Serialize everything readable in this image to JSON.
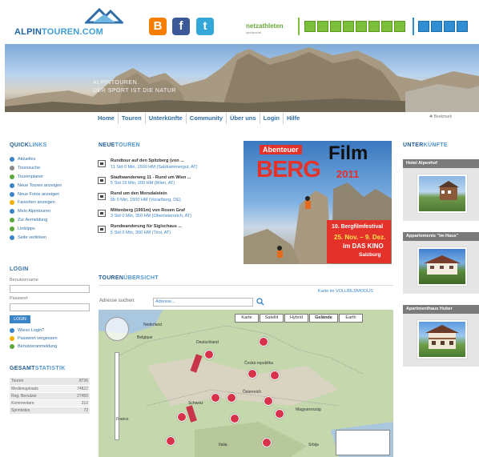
{
  "header": {
    "logo_part1": "ALPIN",
    "logo_part2": "TOUREN.COM",
    "social": [
      "B",
      "f",
      "t"
    ],
    "partner": "netzathleten",
    "partner_sub": "sportportal"
  },
  "banner": {
    "caption_line1": "ALPINTOUREN.",
    "caption_line2": "DER SPORT IST DIE NATUR"
  },
  "nav": {
    "items": [
      "Home",
      "Touren",
      "Unterkünfte",
      "Community",
      "Über uns",
      "Login",
      "Hilfe"
    ],
    "bookmark": "Bookmark"
  },
  "quicklinks": {
    "title_bold": "QUICK",
    "title_light": "LINKS",
    "items": [
      {
        "label": "Aktuelles",
        "color": "#3a84c8"
      },
      {
        "label": "Tourssuche",
        "color": "#8a8a8a"
      },
      {
        "label": "Tourenplaner",
        "color": "#5aa83a"
      },
      {
        "label": "Neue Touren anzeigen",
        "color": "#3a84c8"
      },
      {
        "label": "Neue Fotos anzeigen",
        "color": "#3a84c8"
      },
      {
        "label": "Favoriten anzeigen",
        "color": "#f0b000"
      },
      {
        "label": "Mein Alpintouren",
        "color": "#3a84c8"
      },
      {
        "label": "Zur Anmeldung",
        "color": "#5aa83a"
      },
      {
        "label": "Linktipps",
        "color": "#5aa83a"
      },
      {
        "label": "Seite verlinken",
        "color": "#3a84c8"
      }
    ]
  },
  "login": {
    "title": "LOGIN",
    "user_label": "Benutzername",
    "password_label": "Passwort",
    "button": "LOGIN",
    "links": [
      "Wieso Login?",
      "Passwort vergessen",
      "Benutzeranmeldung"
    ]
  },
  "stats": {
    "title_bold": "GESAMT",
    "title_light": "STATISTIK",
    "rows": [
      {
        "label": "Touren",
        "value": "8736"
      },
      {
        "label": "Medienuploads",
        "value": "74822"
      },
      {
        "label": "Reg. Benutzer",
        "value": "27450"
      },
      {
        "label": "Kommentare",
        "value": "310"
      },
      {
        "label": "Sprintsites",
        "value": "72"
      }
    ]
  },
  "new_tours": {
    "title_bold": "NEUE",
    "title_light": "TOUREN",
    "items": [
      {
        "name": "Rundtour auf den Spitzberg (von ...",
        "meta": "11 Std 0 Min, 1500 HM (Salzkammergut, AT)"
      },
      {
        "name": "Stadtwanderweg 11 - Rund um Wien ...",
        "meta": "5 Std 15 Min, 200 HM (Wien, AT)"
      },
      {
        "name": "Rund um den Morsdalstein",
        "meta": "5h 0 Min, 1500 HM (Vorarlberg, DE)"
      },
      {
        "name": "Mittenberg (1991m) von Rosen Graf",
        "meta": "3 Std 0 Min, 350 HM (Oberösterreich, AT)"
      },
      {
        "name": "Rundwanderung für Siglschaus ...",
        "meta": "5 Std 0 Min, 300 HM (Tirol, AT)"
      }
    ]
  },
  "ad": {
    "line1": "Abenteuer",
    "line2": "Film",
    "line3": "BERG",
    "line4": "2011",
    "line5": "10. Bergfilmfestival",
    "line6": "25. Nov. – 9. Dez.",
    "line7": "im DAS KINO",
    "line8": "Salzburg"
  },
  "overview": {
    "title_bold": "TOUREN",
    "title_light": "ÜBERSICHT",
    "fullscreen_link": "Karte im VOLLBILDMODUS",
    "address_label": "Adresse suchen:",
    "address_placeholder": "Adresse...",
    "map_types": [
      "Karte",
      "Satellit",
      "Hybrid",
      "Gelände",
      "Earth"
    ],
    "map_labels": [
      "Nederland",
      "Belgique",
      "Deutschland",
      "Česká republika",
      "Österreich",
      "Schweiz",
      "Magyarország",
      "France",
      "Italia",
      "Srbija"
    ]
  },
  "accommodations": {
    "title_bold": "UNTER",
    "title_light": "KÜNFTE",
    "items": [
      {
        "name": "Hotel Alpenhof"
      },
      {
        "name": "Appartements \"Im Haus\""
      },
      {
        "name": "Apartmenthaus Huber"
      }
    ]
  }
}
